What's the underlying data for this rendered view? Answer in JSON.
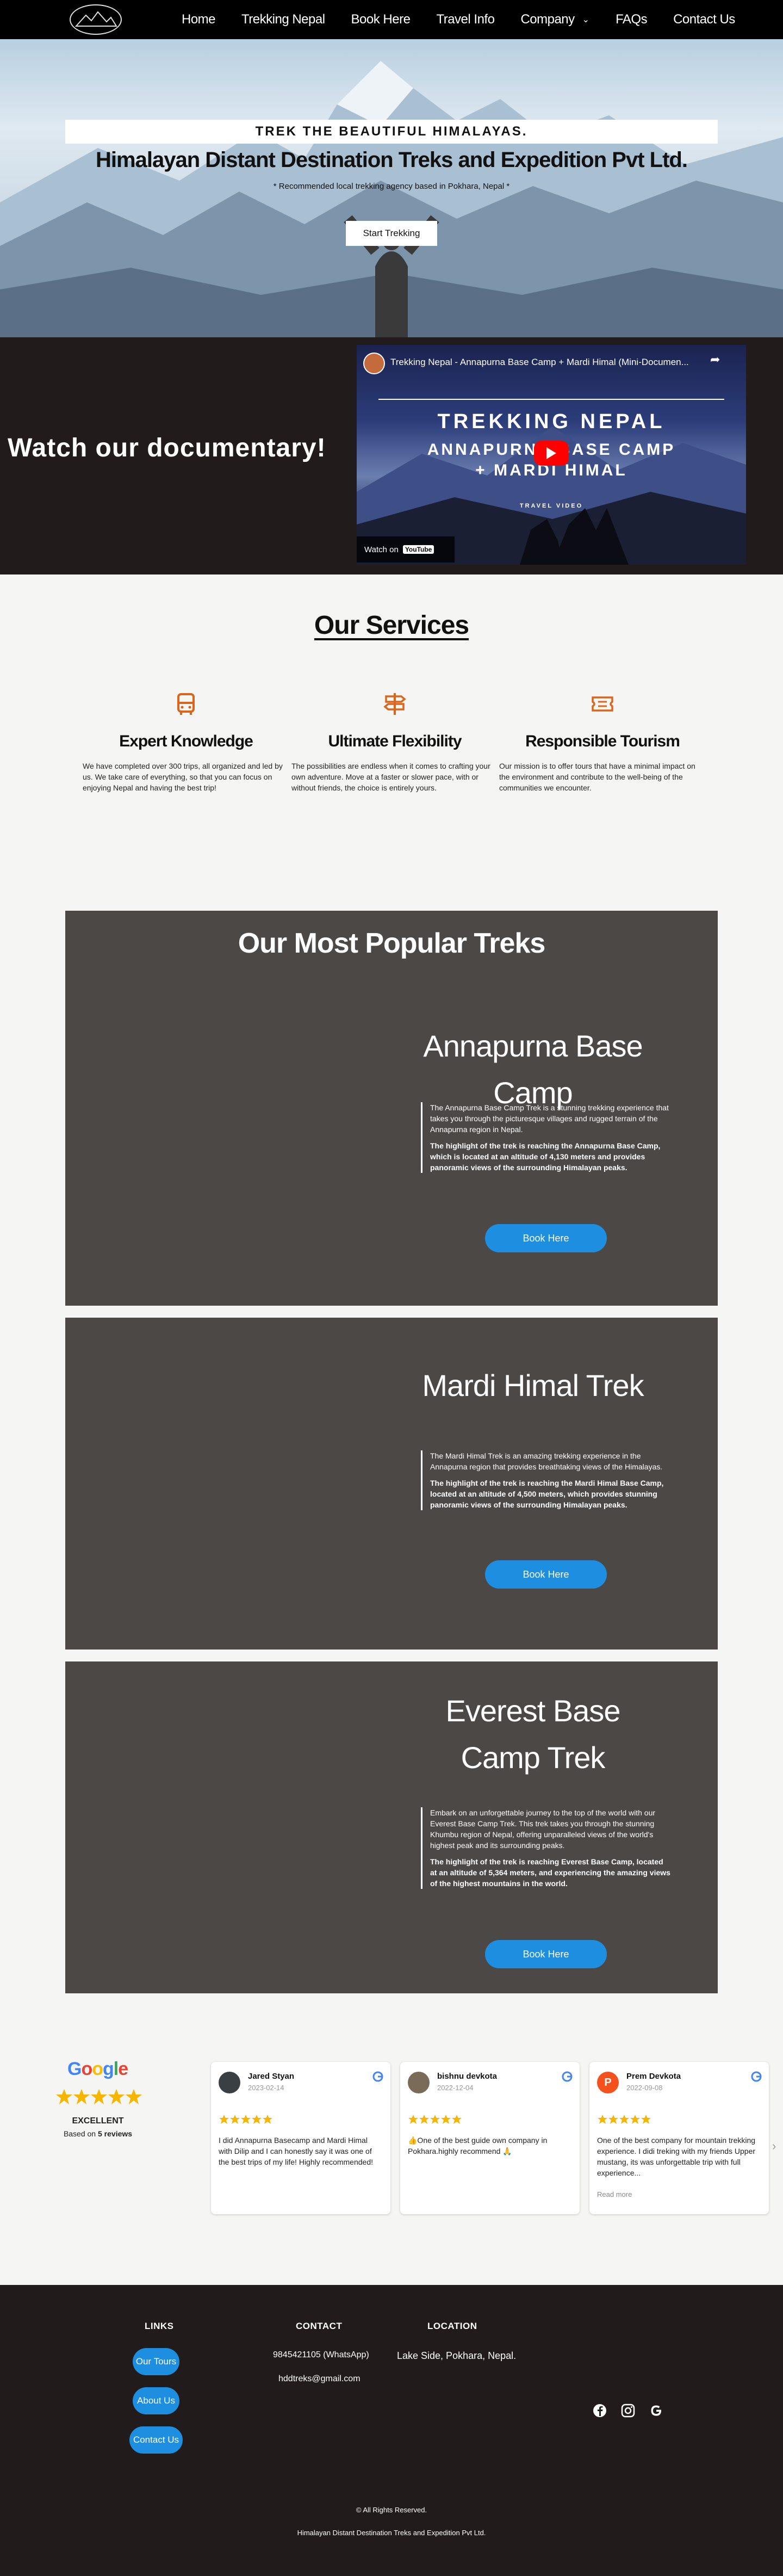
{
  "nav": {
    "logo_alt": "Himalayan Distant Destination logo",
    "items": [
      "Home",
      "Trekking Nepal",
      "Book Here",
      "Travel Info",
      "Company",
      "FAQs",
      "Contact Us"
    ]
  },
  "hero": {
    "banner": "TREK THE BEAUTIFUL HIMALAYAS.",
    "title": "Himalayan Distant Destination Treks and Expedition Pvt Ltd.",
    "subtitle": "* Recommended local trekking agency based in Pokhara, Nepal *",
    "button": "Start Trekking"
  },
  "documentary": {
    "heading": "Watch our documentary!",
    "video": {
      "title": "Trekking Nepal - Annapurna Base Camp + Mardi Himal (Mini-Documen...",
      "line1": "TREKKING NEPAL",
      "line2": "ANNAPURNA BASE CAMP",
      "line3": "+ MARDI HIMAL",
      "line4": "TRAVEL VIDEO",
      "watch_on": "Watch on",
      "youtube": "YouTube"
    }
  },
  "services": {
    "title": "Our Services",
    "items": [
      {
        "icon": "bus-icon",
        "title": "Expert Knowledge",
        "text": "We have completed over 300 trips, all organized and led by us. We take care of everything, so that you can focus on enjoying Nepal and having the best trip!"
      },
      {
        "icon": "signpost-icon",
        "title": "Ultimate Flexibility",
        "text": "The possibilities are endless when it comes to crafting your own adventure. Move at a faster or slower pace, with or without friends, the choice is entirely yours."
      },
      {
        "icon": "ticket-icon",
        "title": "Responsible Tourism",
        "text": "Our mission is to offer tours that have a minimal impact on the environment and contribute to the well-being of the communities we encounter."
      }
    ]
  },
  "treks": {
    "heading": "Our Most Popular Treks",
    "items": [
      {
        "name": "Annapurna Base Camp",
        "desc": "The Annapurna Base Camp Trek is a stunning trekking experience that takes you through the picturesque villages and rugged terrain of the Annapurna region in Nepal.",
        "highlight": "The highlight of the trek is reaching the Annapurna Base Camp, which is located at an altitude of 4,130 meters and provides panoramic views of the surrounding Himalayan peaks.",
        "button": "Book Here"
      },
      {
        "name": "Mardi Himal Trek",
        "desc": "The Mardi Himal Trek is an amazing trekking experience in the Annapurna region that provides breathtaking views of the Himalayas.",
        "highlight": "The highlight of the trek is reaching the Mardi Himal Base Camp, located at an altitude of 4,500 meters, which provides stunning panoramic views of the surrounding Himalayan peaks.",
        "button": "Book Here"
      },
      {
        "name": "Everest Base Camp Trek",
        "desc": "Embark on an unforgettable journey to the top of the world with our Everest Base Camp Trek. This trek takes you through the stunning Khumbu region of Nepal, offering unparalleled views of the world's highest peak and its surrounding peaks.",
        "highlight": "The highlight of the trek is reaching Everest Base Camp, located at an altitude of 5,364 meters, and experiencing the amazing views of the highest mountains in the world.",
        "button": "Book Here"
      }
    ]
  },
  "reviews": {
    "brand": "Google",
    "rating_label": "EXCELLENT",
    "based_on_prefix": "Based on ",
    "based_on_count": "5 reviews",
    "read_more": "Read more",
    "items": [
      {
        "name": "Jared Styan",
        "date": "2023-02-14",
        "text": "I did Annapurna Basecamp and Mardi Himal with Dilip and I can honestly say it was one of the best trips of my life! Highly recommended!",
        "avatar_color": "#3a3f44"
      },
      {
        "name": "bishnu devkota",
        "date": "2022-12-04",
        "text": "👍One of the best guide own company in Pokhara.highly recommend 🙏",
        "avatar_color": "#7a6a58"
      },
      {
        "name": "Prem Devkota",
        "date": "2022-09-08",
        "text": "One of the best company for mountain trekking experience. I didi treking with my friends Upper mustang, its was unforgettable trip with full experience...",
        "avatar_color": "#f4511e",
        "initial": "P"
      }
    ]
  },
  "footer": {
    "links_heading": "LINKS",
    "links": [
      "Our Tours",
      "About Us",
      "Contact Us"
    ],
    "contact_heading": "CONTACT",
    "phone": "9845421105 (WhatsApp)",
    "email": "hddtreks@gmail.com",
    "location_heading": "LOCATION",
    "location": "Lake Side, Pokhara, Nepal.",
    "social": [
      "facebook-icon",
      "instagram-icon",
      "google-icon"
    ],
    "copyright": "© All Rights Reserved.",
    "company": "Himalayan Distant Destination Treks and Expedition Pvt Ltd."
  },
  "colors": {
    "accent_blue": "#1e8fe0",
    "icon_orange": "#d9661c",
    "dark_bg": "#221b1c",
    "trek_card_bg": "#4b4845",
    "star_gold": "#f7b500"
  }
}
